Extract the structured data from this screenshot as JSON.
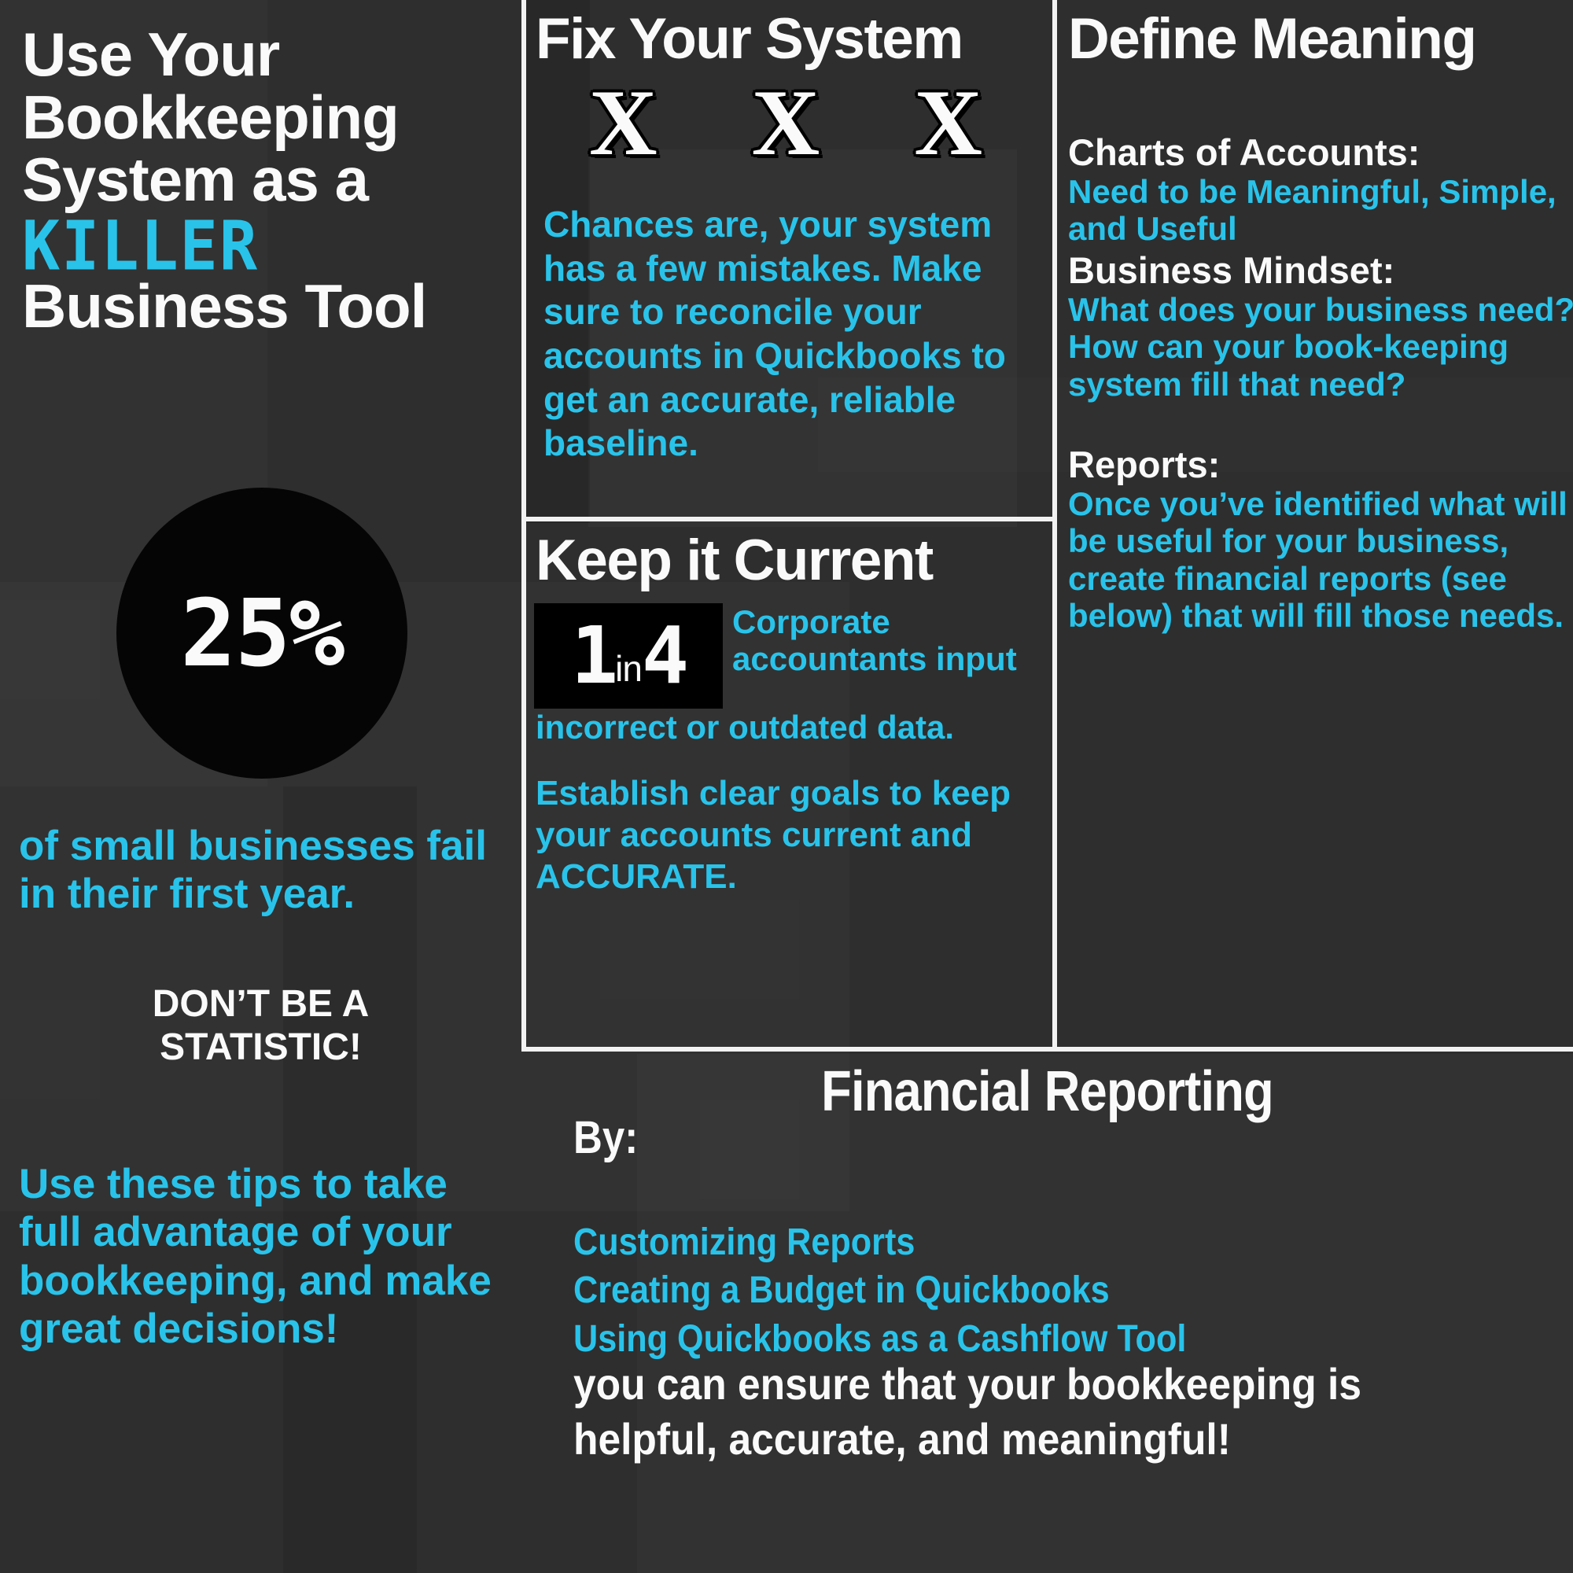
{
  "theme": {
    "background": "#2e2e2e",
    "accent_cyan": "#29c3ea",
    "text_white": "#fafafa",
    "circle_black": "#050505"
  },
  "left": {
    "title_line1": "Use Your",
    "title_line2": "Bookkeeping",
    "title_line3": "System as a",
    "title_emphasis": "KILLER",
    "title_line4": "Business Tool",
    "stat_number": "25%",
    "stat_caption": "of small businesses fail in their first year.",
    "dont_be_line1": "DON’T BE A",
    "dont_be_line2": "STATISTIC!",
    "closing": "Use these tips to take full advantage of your bookkeeping, and make great decisions!"
  },
  "fix_system": {
    "title": "Fix Your System",
    "marks": [
      "X",
      "X",
      "X"
    ],
    "body": "Chances are, your system has a few mistakes. Make sure to reconcile your accounts in Quickbooks to get an accurate, reliable baseline."
  },
  "keep_current": {
    "title": "Keep it Current",
    "ratio_first": "1",
    "ratio_word": "in",
    "ratio_second": "4",
    "stat_right": "Corporate accountants input",
    "stat_tail": "incorrect or outdated  data.",
    "goals": "Establish clear goals to keep your accounts current and ACCURATE."
  },
  "define_meaning": {
    "title": "Define Meaning",
    "blocks": [
      {
        "heading": "Charts of Accounts:",
        "body": "Need to be Meaningful, Simple, and Useful"
      },
      {
        "heading": "Business Mindset:",
        "body": "What does your business need? How can your book-keeping system fill that need?"
      },
      {
        "heading": "Reports:",
        "body": "Once you’ve identified what will be useful for your business, create financial reports (see below) that will fill those needs."
      }
    ]
  },
  "financial_reporting": {
    "title": "Financial Reporting",
    "by_label": "By:",
    "items": [
      "Customizing Reports",
      "Creating a Budget in Quickbooks",
      "Using Quickbooks as a Cashflow Tool"
    ],
    "closing": "you can ensure that your bookkeeping is helpful, accurate, and meaningful!"
  }
}
